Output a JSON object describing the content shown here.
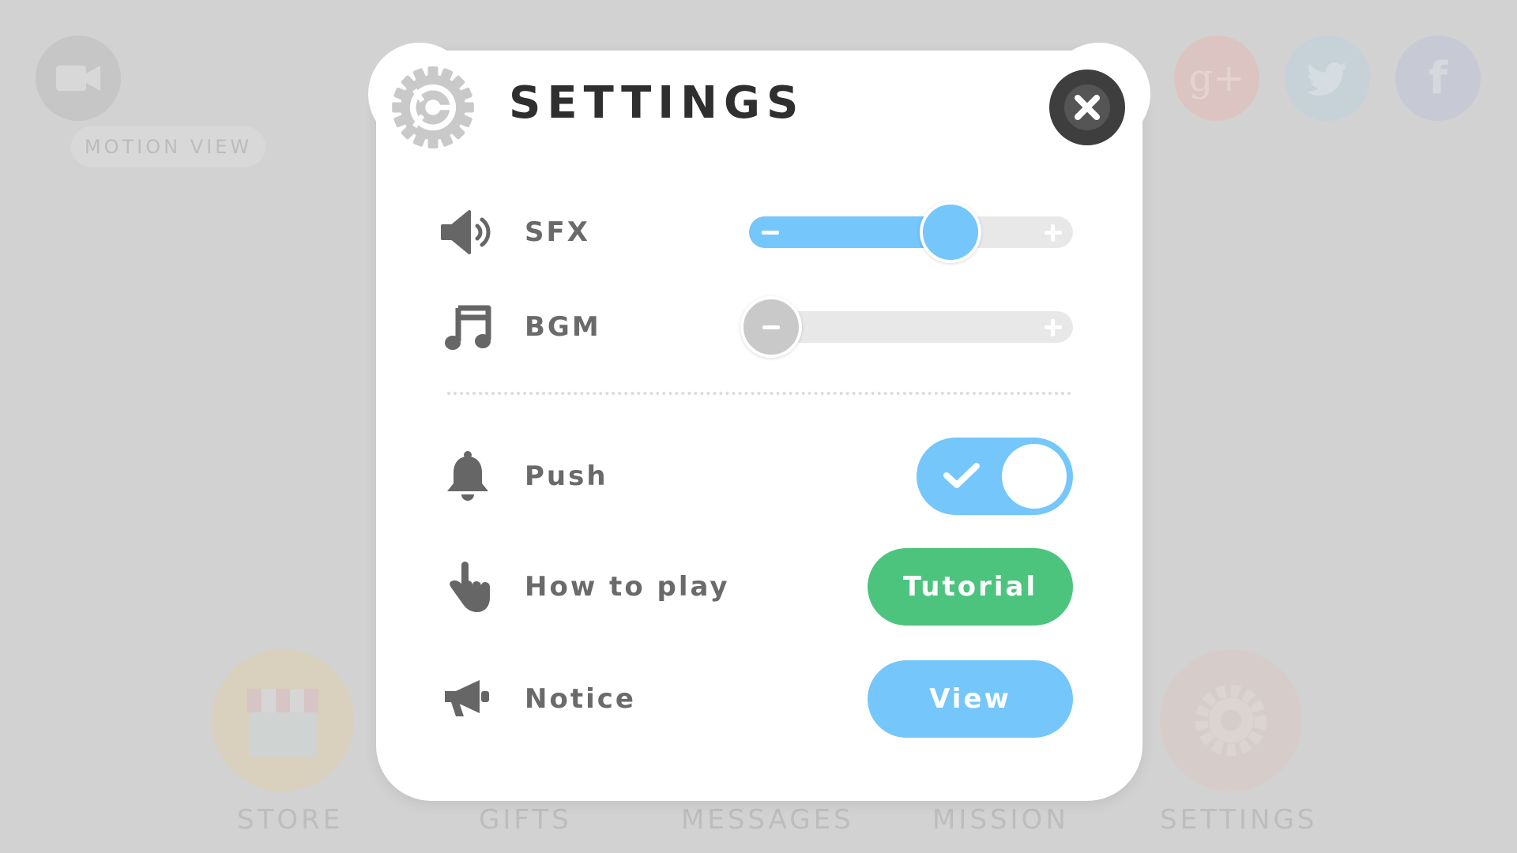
{
  "background": {
    "motion_view_label": "MOTION VIEW",
    "social": [
      "google-plus",
      "twitter",
      "facebook"
    ],
    "bottom_nav": [
      {
        "label": "STORE",
        "icon": "store-icon"
      },
      {
        "label": "GIFTS",
        "icon": "gift-icon"
      },
      {
        "label": "MESSAGES",
        "icon": "message-icon"
      },
      {
        "label": "MISSION",
        "icon": "mission-icon"
      },
      {
        "label": "SETTINGS",
        "icon": "gear-icon"
      }
    ]
  },
  "settings": {
    "title": "SETTINGS",
    "close_icon": "close-icon",
    "sfx": {
      "label": "SFX",
      "value": 0.64
    },
    "bgm": {
      "label": "BGM",
      "value": 0.0
    },
    "push": {
      "label": "Push",
      "enabled": true
    },
    "how_to_play": {
      "label": "How to play",
      "button": "Tutorial"
    },
    "notice": {
      "label": "Notice",
      "button": "View"
    }
  },
  "colors": {
    "accent_blue": "#74c6fb",
    "accent_green": "#4cc47e",
    "close_dark": "#3e3e3e",
    "label_gray": "#6a6a6a",
    "title_dark": "#2f2f2f"
  }
}
